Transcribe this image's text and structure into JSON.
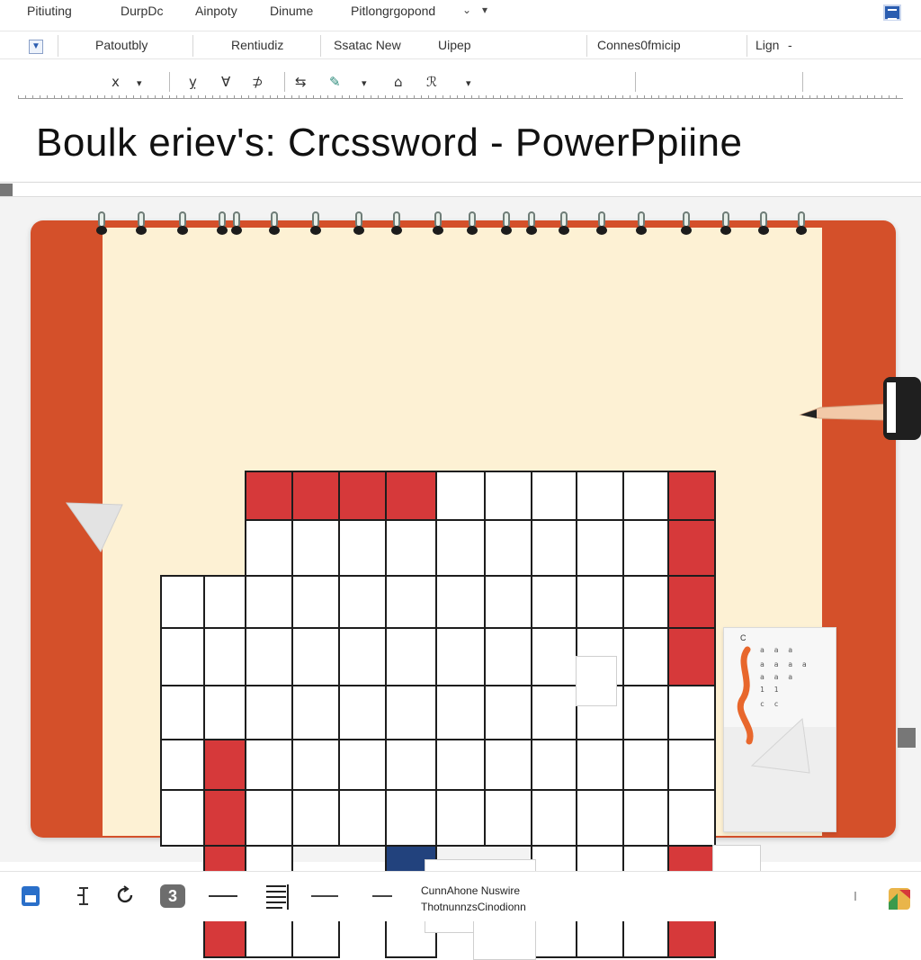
{
  "menu": {
    "items": [
      "Pitiuting",
      "DurpDc",
      "Ainpoty",
      "Dinume",
      "Pitlongrgopond"
    ]
  },
  "ribbon": {
    "items": [
      "Patoutbly",
      "Rentiudiz",
      "Ssatac New",
      "Uipep",
      "Connes0fmicip",
      "Lign"
    ]
  },
  "toolbar": {
    "items": [
      "x",
      "ỵ",
      "Ɐ",
      "⊅",
      "⇆",
      "⌂",
      "ℛ"
    ]
  },
  "document": {
    "title": "Boulk eriev's: Crcssword - PowerPpiine"
  },
  "clue_card": {
    "head": "C",
    "rows": [
      "a a a",
      "a a a a",
      "a a a",
      "1 1",
      "c c"
    ]
  },
  "status": {
    "page_number": "3",
    "line1": "CunnAhone Nuswire",
    "line2": "ThotnunnzsCinodionn"
  },
  "colors": {
    "accent_red": "#d6393a",
    "notebook_orange": "#d4502a",
    "paper": "#fdf1d4",
    "navy": "#22427d"
  }
}
